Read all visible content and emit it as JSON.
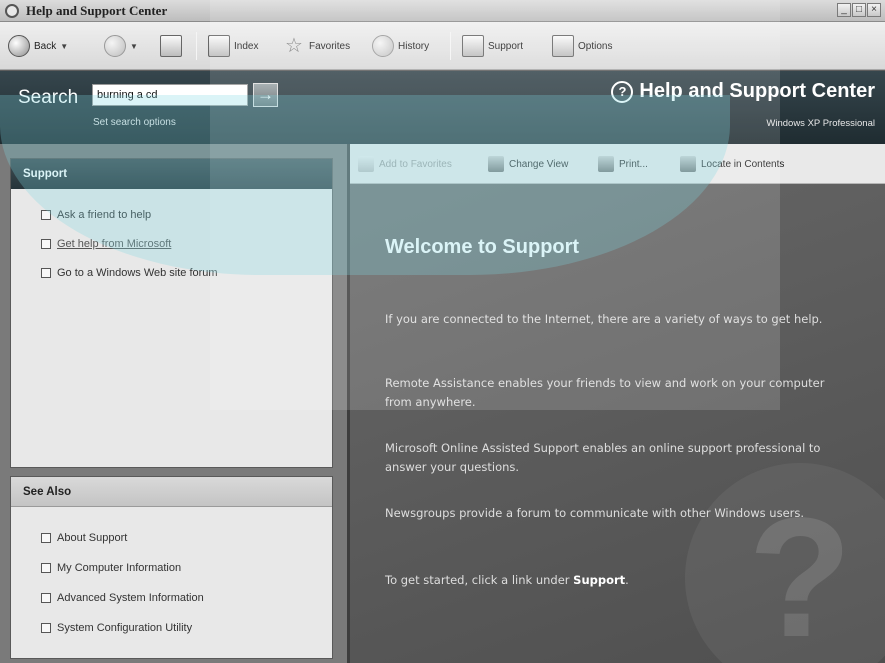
{
  "window": {
    "title": "Help and Support Center",
    "buttons": [
      "_",
      "□",
      "×"
    ]
  },
  "toolbar": {
    "back": "Back",
    "index": "Index",
    "favorites": "Favorites",
    "history": "History",
    "support": "Support",
    "options": "Options"
  },
  "search": {
    "label": "Search",
    "value": "burning a cd",
    "go": "→",
    "options": "Set search options"
  },
  "header": {
    "title": "Help and Support Center",
    "subtitle": "Windows XP Professional"
  },
  "support_panel": {
    "title": "Support",
    "items": [
      "Ask a friend to help",
      "Get help from Microsoft",
      "Go to a Windows Web site forum"
    ]
  },
  "see_also_panel": {
    "title": "See Also",
    "items": [
      "About Support",
      "My Computer Information",
      "Advanced System Information",
      "System Configuration Utility"
    ]
  },
  "commands": {
    "add_favorites": "Add to Favorites",
    "change_view": "Change View",
    "print": "Print...",
    "locate": "Locate in Contents"
  },
  "content": {
    "heading": "Welcome to Support",
    "p1": "If you are connected to the Internet, there are a variety of ways to get help.",
    "p2": "Remote Assistance enables your friends to view and work on your computer from anywhere.",
    "p3": "Microsoft Online Assisted Support enables an online support professional to answer your questions.",
    "p4": "Newsgroups provide a forum to communicate with other Windows users.",
    "p5_prefix": "To get started, click a link under ",
    "p5_bold": "Support",
    "p5_suffix": "."
  },
  "colors": {
    "header_bg": "#26343a",
    "overlay": "#7dd7e1",
    "content_bg": "#5a5a5a"
  }
}
